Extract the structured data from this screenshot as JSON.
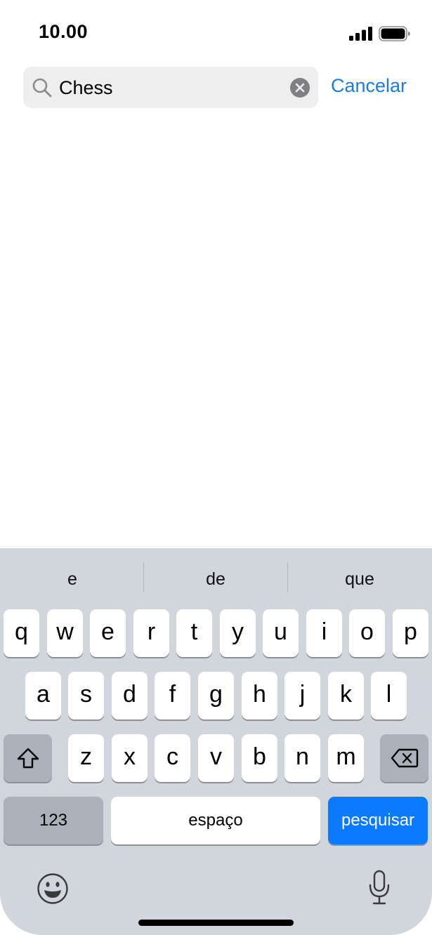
{
  "status": {
    "time": "10.00"
  },
  "search": {
    "value": "Chess",
    "cancel_label": "Cancelar"
  },
  "keyboard": {
    "suggestions": [
      "e",
      "de",
      "que"
    ],
    "row1": [
      "q",
      "w",
      "e",
      "r",
      "t",
      "y",
      "u",
      "i",
      "o",
      "p"
    ],
    "row2": [
      "a",
      "s",
      "d",
      "f",
      "g",
      "h",
      "j",
      "k",
      "l"
    ],
    "row3": [
      "z",
      "x",
      "c",
      "v",
      "b",
      "n",
      "m"
    ],
    "numbers_label": "123",
    "space_label": "espaço",
    "search_label": "pesquisar",
    "icons": {
      "shift": "shift-icon",
      "delete": "backspace-icon",
      "emoji": "emoji-icon",
      "dictation": "microphone-icon"
    }
  },
  "colors": {
    "accent": "#0a7aff",
    "link": "#1a7be8",
    "keyboard_bg": "#d1d5dc"
  }
}
